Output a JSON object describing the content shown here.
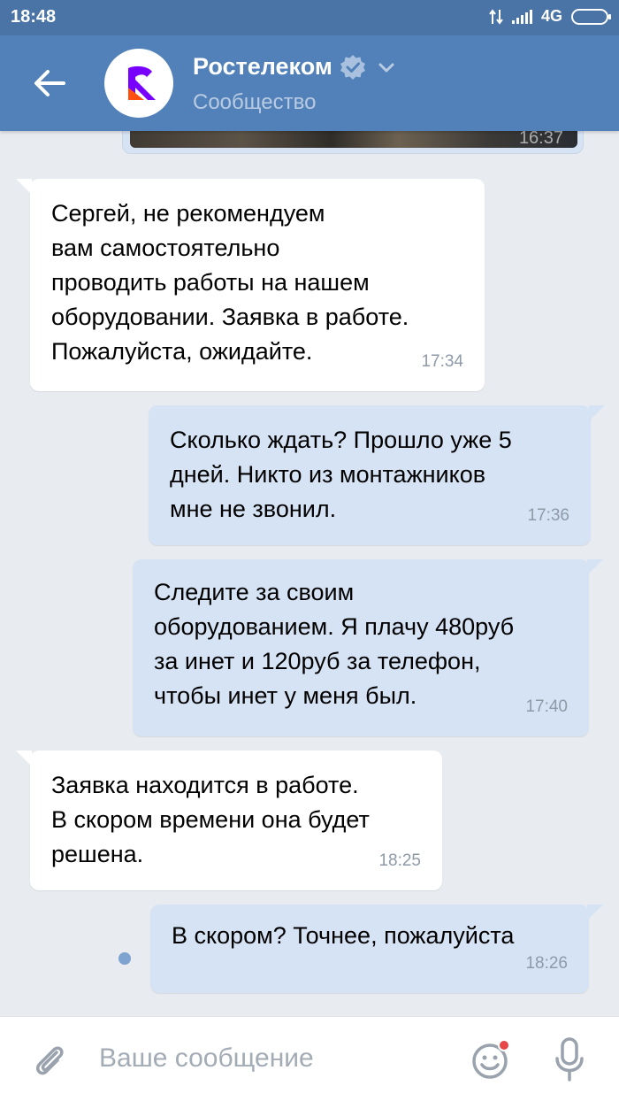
{
  "status_bar": {
    "time": "18:48",
    "network": "4G"
  },
  "header": {
    "title": "Ростелеком",
    "subtitle": "Сообщество",
    "verified_icon": "verified-check-icon",
    "back_icon": "arrow-left-icon",
    "dropdown_icon": "chevron-down-icon"
  },
  "messages": [
    {
      "direction": "out",
      "kind": "image",
      "time": "16:37"
    },
    {
      "direction": "in",
      "text": "Сергей, не рекомендуем\nвам самостоятельно\nпроводить работы на нашем\nоборудовании. Заявка в работе.\nПожалуйста, ожидайте.",
      "time": "17:34"
    },
    {
      "direction": "out",
      "text": "Сколько ждать? Прошло уже 5\nдней. Никто из монтажников\nмне не звонил.",
      "time": "17:36"
    },
    {
      "direction": "out",
      "text": "Следите за своим\nоборудованием. Я плачу 480руб\nза инет и 120руб за телефон,\nчтобы инет у меня был.",
      "time": "17:40"
    },
    {
      "direction": "in",
      "text": "Заявка находится в работе.\nВ скором времени она будет\nрешена.",
      "time": "18:25"
    },
    {
      "direction": "out",
      "text": "В скором? Точнее, пожалуйста",
      "time": "18:26",
      "unread": true
    }
  ],
  "composer": {
    "placeholder": "Ваше сообщение",
    "attach_icon": "paperclip-icon",
    "emoji_icon": "smiley-icon",
    "mic_icon": "microphone-icon"
  },
  "colors": {
    "header_bg": "#5181b8",
    "status_bg": "#4a74a6",
    "chat_bg": "#e8ebf0",
    "incoming_bubble": "#ffffff",
    "outgoing_bubble": "#d6e3f4",
    "rostelecom_orange": "#ff4f12",
    "rostelecom_purple": "#7700ff",
    "notification_dot": "#e64646"
  }
}
